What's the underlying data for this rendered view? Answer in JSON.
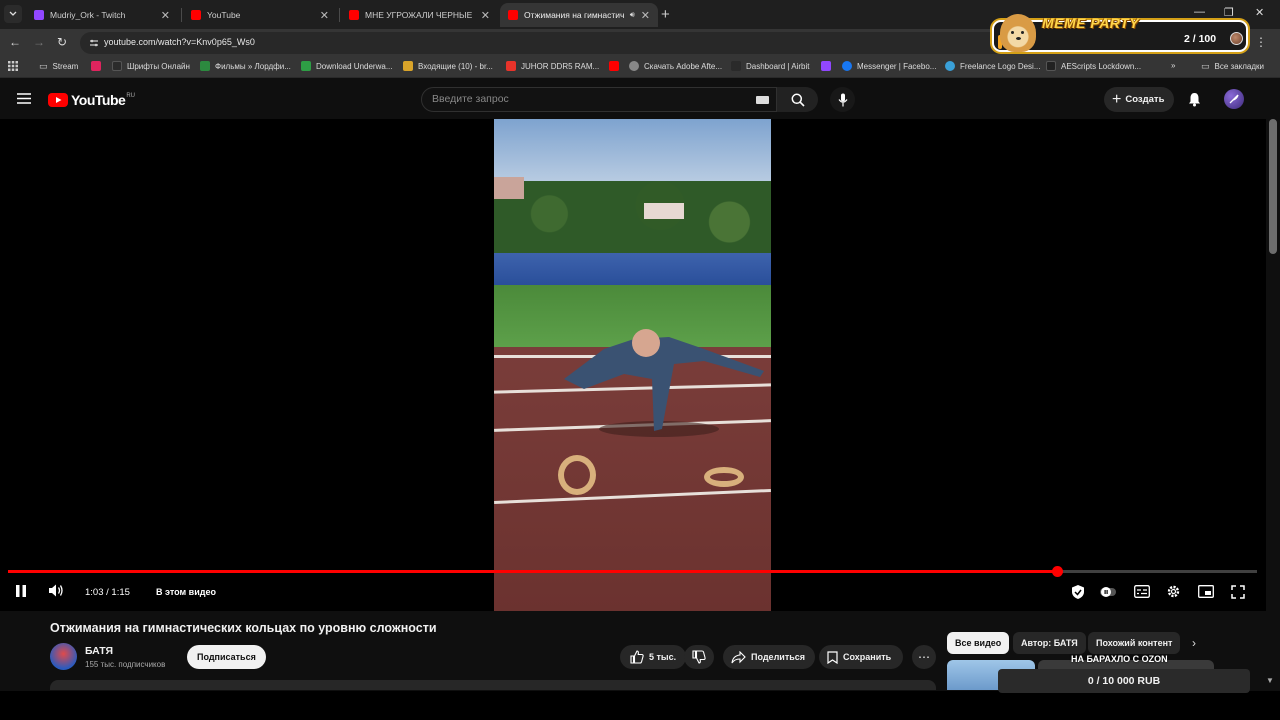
{
  "browser": {
    "tabs": [
      {
        "title": "Mudriy_Ork - Twitch",
        "favicon_color": "#9147ff"
      },
      {
        "title": "YouTube",
        "favicon_color": "#ff0000"
      },
      {
        "title": "МНЕ УГРОЖАЛИ ЧЕРНЫЕ ПУШ",
        "favicon_color": "#ff0000"
      },
      {
        "title": "Отжимания на гимнастич",
        "favicon_color": "#ff0000",
        "active": true
      }
    ],
    "url": "youtube.com/watch?v=Knv0p65_Ws0",
    "bookmarks": [
      {
        "label": "Stream",
        "icon": "folder-icon"
      },
      {
        "label": "",
        "icon": "red-app-icon",
        "color": "#e0245e"
      },
      {
        "label": "Шрифты Онлайн",
        "icon": "fonts-icon",
        "color": "#2b2b2b"
      },
      {
        "label": "Фильмы » Лордфи...",
        "icon": "hd-icon",
        "color": "#2c8a3f"
      },
      {
        "label": "Download Underwa...",
        "icon": "ae-icon",
        "color": "#2e9e45"
      },
      {
        "label": "Входящие (10) - br...",
        "icon": "mail-icon",
        "color": "#d9a42a"
      },
      {
        "label": "JUHOR DDR5 RAM...",
        "icon": "aliexpress-icon",
        "color": "#e8332a"
      },
      {
        "label": "",
        "icon": "youtube-icon",
        "color": "#ff0000"
      },
      {
        "label": "Скачать Adobe Afte...",
        "icon": "globe-icon",
        "color": "#888888"
      },
      {
        "label": "Dashboard | Airbit",
        "icon": "airbit-icon",
        "color": "#2a2a2a"
      },
      {
        "label": "",
        "icon": "twitch-icon",
        "color": "#9147ff"
      },
      {
        "label": "Messenger | Facebo...",
        "icon": "facebook-icon",
        "color": "#1877f2"
      },
      {
        "label": "Freelance Logo Desi...",
        "icon": "gear-icon",
        "color": "#3aa0d8"
      },
      {
        "label": "AEScripts Lockdown...",
        "icon": "aescripts-icon",
        "color": "#222222"
      }
    ],
    "all_bookmarks_label": "Все закладки"
  },
  "youtube": {
    "logo_text": "YouTube",
    "region": "RU",
    "search_placeholder": "Введите запрос",
    "create_label": "Создать"
  },
  "player": {
    "current_time": "1:03",
    "duration": "1:15",
    "time_display": "1:03 / 1:15",
    "progress_fraction": 0.84,
    "chapter_label": "В этом видео",
    "is_playing": true,
    "accent_color": "#ff0000"
  },
  "video": {
    "title": "Отжимания на гимнастических кольцах по уровню сложности",
    "channel": "БАТЯ",
    "subscribers": "155 тыс. подписчиков",
    "subscribe_label": "Подписаться",
    "likes": "5 тыс.",
    "share_label": "Поделиться",
    "save_label": "Сохранить"
  },
  "sidebar": {
    "chips": [
      "Все видео",
      "Автор: БАТЯ",
      "Похожий контент"
    ],
    "thumb_overlay_text": "НА БАРАХЛО С OZON"
  },
  "overlays": {
    "meme_party": {
      "title": "MEME PARTY",
      "count": "2 / 100"
    },
    "donation": "0 / 10 000 RUB"
  }
}
